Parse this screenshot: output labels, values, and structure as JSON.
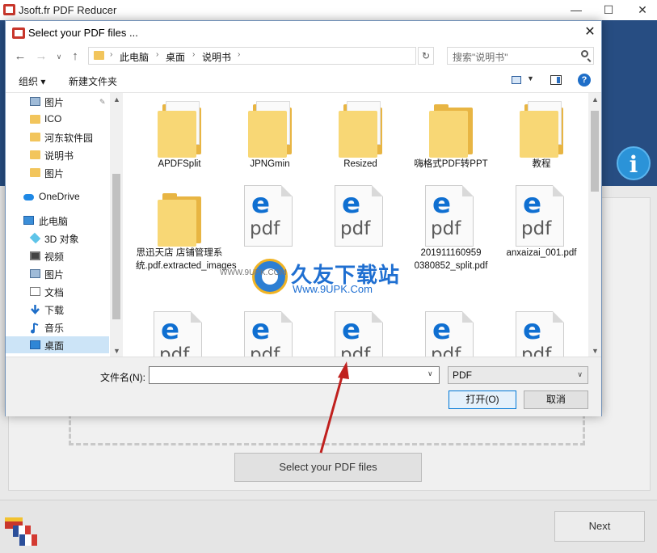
{
  "app": {
    "title": "Jsoft.fr PDF Reducer",
    "select_button": "Select your PDF files",
    "next_button": "Next",
    "minimize": "—",
    "maximize": "☐",
    "close": "✕",
    "info_glyph": "i"
  },
  "dialog": {
    "title": "Select your PDF files ...",
    "close": "✕",
    "address": {
      "crumbs": [
        "此电脑",
        "桌面",
        "说明书"
      ],
      "separator": "›"
    },
    "search_placeholder": "搜索\"说明书\"",
    "toolbar": {
      "organize": "组织 ▾",
      "new_folder": "新建文件夹",
      "help": "?"
    },
    "nav": [
      {
        "label": "图片",
        "icon": "pictures-icon",
        "pinned": true
      },
      {
        "label": "ICO",
        "icon": "folder-icon"
      },
      {
        "label": "河东软件园",
        "icon": "folder-icon"
      },
      {
        "label": "说明书",
        "icon": "folder-icon"
      },
      {
        "label": "图片",
        "icon": "folder-icon"
      },
      {
        "label": "OneDrive",
        "icon": "onedrive-icon"
      },
      {
        "label": "此电脑",
        "icon": "this-pc-icon"
      },
      {
        "label": "3D 对象",
        "icon": "3d-objects-icon"
      },
      {
        "label": "视频",
        "icon": "videos-icon"
      },
      {
        "label": "图片",
        "icon": "pictures-icon"
      },
      {
        "label": "文档",
        "icon": "documents-icon"
      },
      {
        "label": "下载",
        "icon": "downloads-icon"
      },
      {
        "label": "音乐",
        "icon": "music-icon"
      },
      {
        "label": "桌面",
        "icon": "desktop-icon",
        "selected": true
      }
    ],
    "files": [
      {
        "label": "APDFSplit",
        "type": "folder"
      },
      {
        "label": "JPNGmin",
        "type": "folder"
      },
      {
        "label": "Resized",
        "type": "folder"
      },
      {
        "label": "嗨格式PDF转PPT",
        "type": "folder"
      },
      {
        "label": "教程",
        "type": "folder"
      },
      {
        "label": "思迅天店 店铺管理系统.pdf.extracted_images",
        "type": "folder"
      },
      {
        "label": "",
        "type": "pdf"
      },
      {
        "label": "",
        "type": "pdf"
      },
      {
        "label": "201911160959 0380852_split.pdf",
        "type": "pdf"
      },
      {
        "label": "anxaizai_001.pdf",
        "type": "pdf"
      },
      {
        "label": "",
        "type": "pdf"
      },
      {
        "label": "",
        "type": "pdf"
      },
      {
        "label": "",
        "type": "pdf"
      },
      {
        "label": "",
        "type": "pdf"
      },
      {
        "label": "",
        "type": "pdf"
      }
    ],
    "pdf_glyph": "e",
    "pdf_text": "pdf",
    "filename_label": "文件名(N):",
    "filename_value": "",
    "filetype_value": "PDF",
    "open_button": "打开(O)",
    "cancel_button": "取消"
  },
  "watermark": {
    "cn": "久友下载站",
    "url": "Www.9UPK.Com",
    "small": "WWW.9UPK.COM"
  },
  "colors": {
    "header_blue": "#274d82",
    "accent_blue": "#0078d7",
    "arrow_red": "#c0201e"
  }
}
